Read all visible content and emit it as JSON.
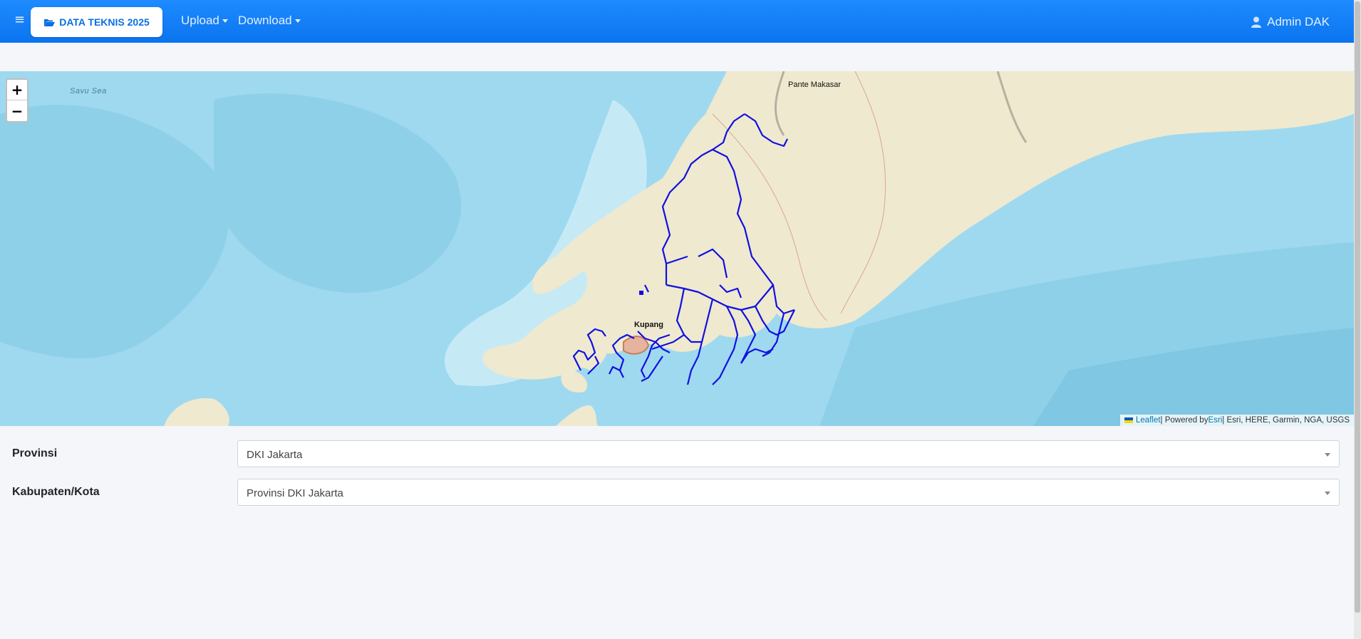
{
  "navbar": {
    "brand_label": "DATA TEKNIS 2025",
    "menu": [
      {
        "label": "Upload"
      },
      {
        "label": "Download"
      }
    ],
    "user_label": "Admin DAK",
    "icons": {
      "menu": "hamburger-icon",
      "brand": "folder-open-icon",
      "user": "user-icon"
    },
    "colors": {
      "accent": "#0b74f0",
      "brand_text": "#0b6fe0"
    }
  },
  "map": {
    "zoom_in": "+",
    "zoom_out": "−",
    "labels": {
      "sea": "Savu Sea",
      "city_north": "Pante Makasar",
      "city_main": "Kupang"
    },
    "attribution": {
      "leaflet": "Leaflet",
      "sep1": " | Powered by ",
      "esri": "Esri",
      "rest": " | Esri, HERE, Garmin, NGA, USGS"
    },
    "colors": {
      "water": "#9fd9ef",
      "land": "#efe9cf",
      "route": "#1010e0"
    }
  },
  "form": {
    "provinsi": {
      "label": "Provinsi",
      "value": "DKI Jakarta"
    },
    "kabupaten": {
      "label": "Kabupaten/Kota",
      "value": "Provinsi DKI Jakarta"
    }
  }
}
